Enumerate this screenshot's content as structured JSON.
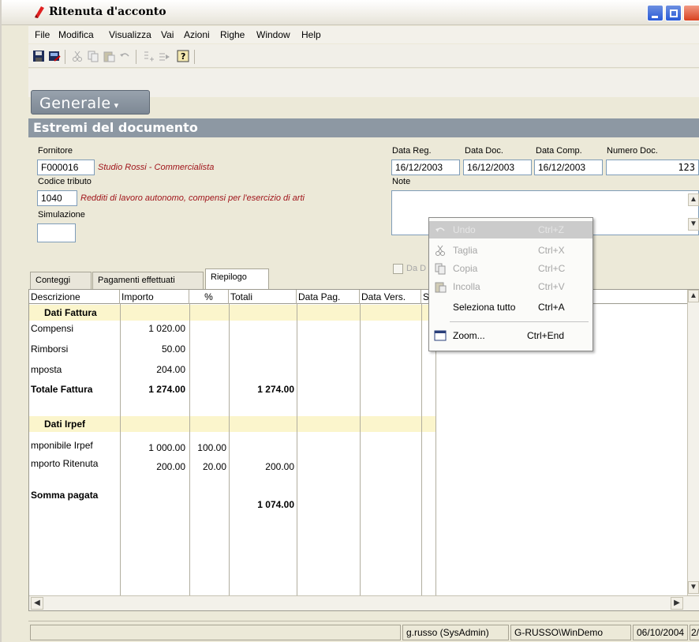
{
  "window": {
    "title": "Ritenuta d'acconto"
  },
  "menubar": {
    "items": [
      "File",
      "Modifica",
      "Visualizza",
      "Vai",
      "Azioni",
      "Righe",
      "Window",
      "Help"
    ]
  },
  "generale": {
    "label": "Generale"
  },
  "section": {
    "title": "Estremi del documento"
  },
  "form": {
    "fornitore_label": "Fornitore",
    "fornitore_code": "F000016",
    "fornitore_name": "Studio Rossi - Commercialista",
    "codice_tributo_label": "Codice tributo",
    "codice_tributo_code": "1040",
    "codice_tributo_desc": "Redditi di lavoro autonomo, compensi per l'esercizio di arti",
    "simulazione_label": "Simulazione",
    "simulazione_value": "",
    "data_reg_label": "Data Reg.",
    "data_reg": "16/12/2003",
    "data_doc_label": "Data Doc.",
    "data_doc": "16/12/2003",
    "data_comp_label": "Data Comp.",
    "data_comp": "16/12/2003",
    "numero_doc_label": "Numero Doc.",
    "numero_doc": "123",
    "note_label": "Note",
    "note_value": "",
    "da_label": "Da D"
  },
  "tabs": [
    "Conteggi",
    "Pagamenti effettuati",
    "Riepilogo"
  ],
  "grid": {
    "columns": [
      "Descrizione",
      "Importo",
      "%",
      "Totali",
      "Data Pag.",
      "Data Vers.",
      "S"
    ],
    "rows": [
      {
        "type": "band",
        "descrizione": "Dati Fattura"
      },
      {
        "descrizione": "Compensi",
        "importo": "1 020.00",
        "perc": "",
        "totali": ""
      },
      {
        "descrizione": "Rimborsi",
        "importo": "50.00",
        "perc": "",
        "totali": ""
      },
      {
        "descrizione": "mposta",
        "importo": "204.00",
        "perc": "",
        "totali": ""
      },
      {
        "descrizione": "Totale Fattura",
        "importo": "1 274.00",
        "perc": "",
        "totali": "1 274.00",
        "bold": true
      },
      {
        "type": "band",
        "descrizione": "Dati Irpef"
      },
      {
        "descrizione": "mponibile Irpef",
        "importo": "1 000.00",
        "perc": "100.00",
        "totali": ""
      },
      {
        "descrizione": "mporto Ritenuta",
        "importo": "200.00",
        "perc": "20.00",
        "totali": "200.00"
      },
      {
        "descrizione": "Somma pagata",
        "importo": "",
        "perc": "",
        "totali": "1 074.00",
        "bold": true
      }
    ]
  },
  "context_menu": {
    "items": [
      {
        "label": "Undo",
        "shortcut": "Ctrl+Z",
        "state": "highlight",
        "icon": "undo-icon"
      },
      {
        "label": "Taglia",
        "shortcut": "Ctrl+X",
        "state": "disabled",
        "icon": "scissors-icon"
      },
      {
        "label": "Copia",
        "shortcut": "Ctrl+C",
        "state": "disabled",
        "icon": "copy-icon"
      },
      {
        "label": "Incolla",
        "shortcut": "Ctrl+V",
        "state": "disabled",
        "icon": "paste-icon"
      },
      {
        "label": "Seleziona tutto",
        "shortcut": "Ctrl+A",
        "state": "normal",
        "icon": ""
      },
      {
        "label": "Zoom...",
        "shortcut": "Ctrl+End",
        "state": "normal",
        "icon": "zoom-window-icon"
      }
    ]
  },
  "statusbar": {
    "user": "g.russo (SysAdmin)",
    "machine": "G-RUSSO\\WinDemo",
    "date": "06/10/2004",
    "extra": "2/"
  },
  "colors": {
    "section_header": "#8d98a3",
    "band": "#fbf5cc",
    "red_text": "#a0151b"
  }
}
